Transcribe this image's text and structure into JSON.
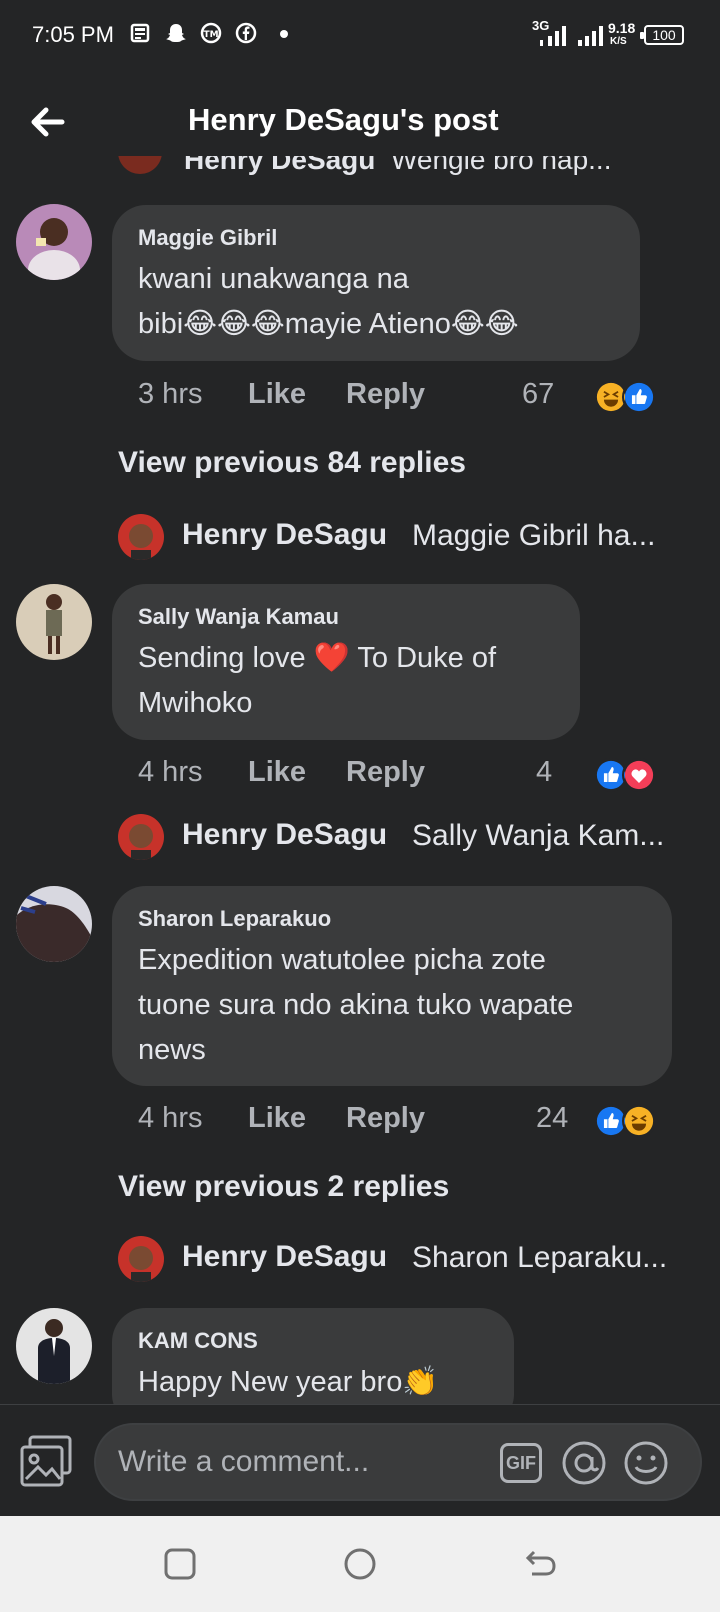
{
  "status_bar": {
    "time": "7:05 PM",
    "network": "3G",
    "speed_value": "9.18",
    "speed_unit": "K/S",
    "battery": "100",
    "notification_icons": [
      "news-icon",
      "snapchat-icon",
      "messenger-icon",
      "facebook-icon",
      "dot-icon"
    ]
  },
  "header": {
    "title": "Henry DeSagu's post"
  },
  "cut_off_reply": {
    "author": "Henry DeSagu",
    "text": "Wengie bro hap..."
  },
  "comments": [
    {
      "author": "Maggie Gibril",
      "text_line1": "kwani unakwanga na",
      "text_line2": "bibi😂😂😂mayie Atieno😂😂",
      "time": "3 hrs",
      "like": "Like",
      "reply": "Reply",
      "reactions": [
        "haha",
        "like"
      ],
      "count": "67",
      "view_previous": "View previous 84 replies",
      "reply_preview": {
        "author": "Henry DeSagu",
        "text": "Maggie Gibril ha..."
      }
    },
    {
      "author": "Sally Wanja Kamau",
      "text_line1": "Sending love ❤️ To Duke of",
      "text_line2": "Mwihoko",
      "time": "4 hrs",
      "like": "Like",
      "reply": "Reply",
      "reactions": [
        "like",
        "love"
      ],
      "count": "4",
      "reply_preview": {
        "author": "Henry DeSagu",
        "text": "Sally Wanja Kam..."
      }
    },
    {
      "author": "Sharon Leparakuo",
      "text_line1": "Expedition watutolee picha zote",
      "text_line2": "tuone sura ndo akina tuko wapate",
      "text_line3": "news",
      "time": "4 hrs",
      "like": "Like",
      "reply": "Reply",
      "reactions": [
        "like",
        "haha"
      ],
      "count": "24",
      "view_previous": "View previous 2 replies",
      "reply_preview": {
        "author": "Henry DeSagu",
        "text": "Sharon Leparaku..."
      }
    },
    {
      "author": "KAM CONS",
      "text_line1": "Happy New year bro👏"
    }
  ],
  "composer": {
    "placeholder": "Write a comment...",
    "gif_label": "GIF"
  },
  "colors": {
    "background": "#242526",
    "bubble": "#3a3b3c",
    "text": "#e4e6eb",
    "secondary_text": "#b0b3b8",
    "like_blue": "#1877f2",
    "love_red": "#f33e58",
    "haha_yellow": "#f7b125"
  }
}
